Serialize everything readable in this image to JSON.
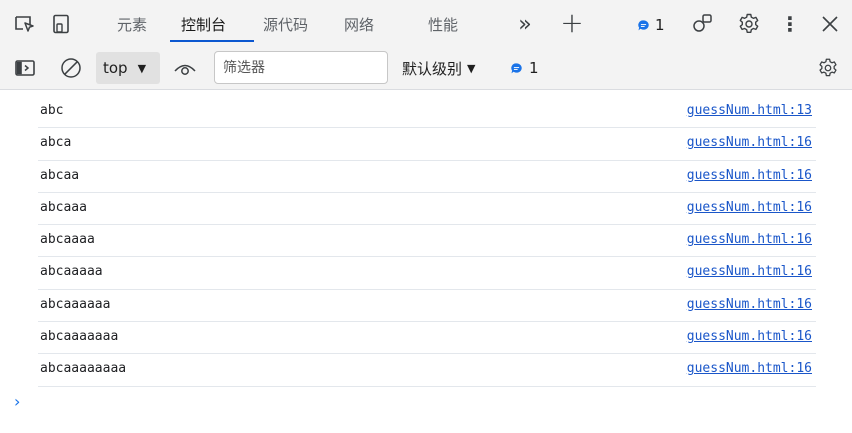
{
  "tabs": [
    {
      "label": "元素",
      "active": false
    },
    {
      "label": "控制台",
      "active": true
    },
    {
      "label": "源代码",
      "active": false
    },
    {
      "label": "网络",
      "active": false
    },
    {
      "label": "性能",
      "active": false
    }
  ],
  "topbar": {
    "more_tabs_glyph": "»",
    "add_tab_glyph": "+",
    "issues_count": "1",
    "menu_glyph": "⋮",
    "close_glyph": "✕"
  },
  "toolbar": {
    "context_value": "top",
    "filter_placeholder": "筛选器",
    "levels_label": "默认级别",
    "issues_count": "1"
  },
  "console_messages": [
    {
      "text": "abc",
      "source": "guessNum.html:13"
    },
    {
      "text": "abca",
      "source": "guessNum.html:16"
    },
    {
      "text": "abcaa",
      "source": "guessNum.html:16"
    },
    {
      "text": "abcaaa",
      "source": "guessNum.html:16"
    },
    {
      "text": "abcaaaa",
      "source": "guessNum.html:16"
    },
    {
      "text": "abcaaaaa",
      "source": "guessNum.html:16"
    },
    {
      "text": "abcaaaaaa",
      "source": "guessNum.html:16"
    },
    {
      "text": "abcaaaaaaa",
      "source": "guessNum.html:16"
    },
    {
      "text": "abcaaaaaaaa",
      "source": "guessNum.html:16"
    }
  ],
  "icons": {
    "inspect": "inspect-element-icon",
    "device": "device-toolbar-icon",
    "sidebar": "sidebar-toggle-icon",
    "clear": "clear-console-icon",
    "eye": "live-expression-icon",
    "issues": "issues-icon",
    "customize": "customize-icon",
    "settings": "settings-gear-icon"
  },
  "colors": {
    "accent": "#0b57d0",
    "link": "#1a56c9",
    "issue_badge": "#1a73e8"
  }
}
